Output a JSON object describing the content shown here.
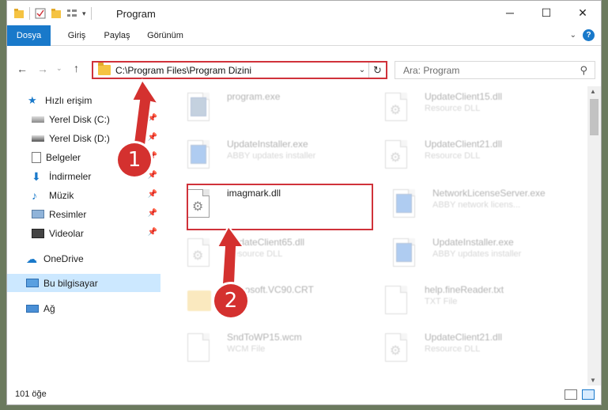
{
  "window": {
    "title": "Program"
  },
  "ribbon": {
    "tabs": [
      "Dosya",
      "Giriş",
      "Paylaş",
      "Görünüm"
    ]
  },
  "address": {
    "path": "C:\\Program Files\\Program Dizini"
  },
  "search": {
    "placeholder": "Ara: Program"
  },
  "sidebar": {
    "items": [
      {
        "label": "Hızlı erişim",
        "icon": "star-icon"
      },
      {
        "label": "Yerel Disk (C:)",
        "icon": "drive-icon",
        "pinned": true
      },
      {
        "label": "Yerel Disk (D:)",
        "icon": "drive-icon",
        "pinned": true
      },
      {
        "label": "Belgeler",
        "icon": "documents-icon",
        "pinned": true
      },
      {
        "label": "İndirmeler",
        "icon": "download-icon",
        "pinned": true
      },
      {
        "label": "Müzik",
        "icon": "music-icon",
        "pinned": true
      },
      {
        "label": "Resimler",
        "icon": "pictures-icon",
        "pinned": true
      },
      {
        "label": "Videolar",
        "icon": "videos-icon",
        "pinned": true
      },
      {
        "label": "OneDrive",
        "icon": "cloud-icon"
      },
      {
        "label": "Bu bilgisayar",
        "icon": "computer-icon",
        "selected": true
      },
      {
        "label": "Ağ",
        "icon": "network-icon"
      }
    ]
  },
  "files": {
    "left": [
      {
        "name": "program.exe",
        "desc": ""
      },
      {
        "name": "UpdateInstaller.exe",
        "desc": "ABBY updates installer"
      },
      {
        "name": "imagmark.dll",
        "desc": ""
      },
      {
        "name": "UpdateClient65.dll",
        "desc": "Resource DLL"
      },
      {
        "name": "Microsoft.VC90.CRT",
        "desc": ""
      },
      {
        "name": "SndToWP15.wcm",
        "desc": "WCM File"
      }
    ],
    "right": [
      {
        "name": "UpdateClient15.dll",
        "desc": "Resource DLL"
      },
      {
        "name": "UpdateClient21.dll",
        "desc": "Resource DLL"
      },
      {
        "name": "NetworkLicenseServer.exe",
        "desc": "ABBY network licens..."
      },
      {
        "name": "UpdateInstaller.exe",
        "desc": "ABBY updates installer"
      },
      {
        "name": "help.fineReader.txt",
        "desc": "TXT File"
      },
      {
        "name": "UpdateClient21.dll",
        "desc": "Resource DLL"
      }
    ]
  },
  "status": {
    "count": "101 öğe"
  },
  "callouts": {
    "one": "1",
    "two": "2"
  },
  "colors": {
    "accent": "#1979ca",
    "callout": "#d4312f",
    "highlight": "#d0323a"
  }
}
